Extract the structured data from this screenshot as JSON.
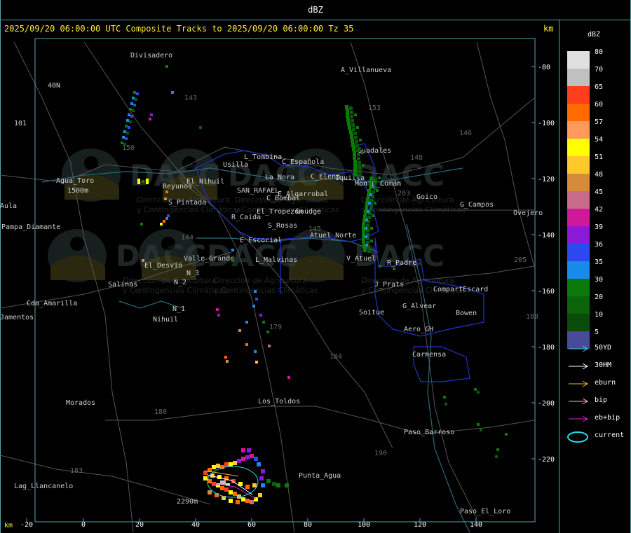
{
  "window": {
    "title": "dBZ"
  },
  "header": {
    "text": "2025/09/20 06:00:00 UTC Composite Tracks to 2025/09/20 06:00:00 Tz 35",
    "km_label": "km"
  },
  "legend": {
    "title": "dBZ",
    "scale": [
      {
        "label": "80",
        "color": "#e0e0e0"
      },
      {
        "label": "70",
        "color": "#c0c0c0"
      },
      {
        "label": "65",
        "color": "#ff3d1f"
      },
      {
        "label": "60",
        "color": "#ff6a00"
      },
      {
        "label": "57",
        "color": "#ff9a5a"
      },
      {
        "label": "54",
        "color": "#ffff00"
      },
      {
        "label": "51",
        "color": "#ffc82a"
      },
      {
        "label": "48",
        "color": "#d68a3a"
      },
      {
        "label": "45",
        "color": "#c86a8a"
      },
      {
        "label": "42",
        "color": "#d0189a"
      },
      {
        "label": "39",
        "color": "#8a1ad8"
      },
      {
        "label": "36",
        "color": "#2a4af0"
      },
      {
        "label": "35",
        "color": "#1a8ae8"
      },
      {
        "label": "30",
        "color": "#0a7a0a"
      },
      {
        "label": "20",
        "color": "#0a640a"
      },
      {
        "label": "10",
        "color": "#0a4a0a"
      },
      {
        "label": "5",
        "color": "#4a4a9a"
      }
    ],
    "tracks": [
      {
        "label": "50YD",
        "color": "#22d8e8"
      },
      {
        "label": "30HM",
        "color": "#ffffff"
      },
      {
        "label": "eburn",
        "color": "#ffb020"
      },
      {
        "label": "bip",
        "color": "#ffb0c0"
      },
      {
        "label": "eb+bip",
        "color": "#e020e0"
      },
      {
        "label": "current",
        "color": "#22d8e8"
      }
    ]
  },
  "axes": {
    "x_ticks": [
      "-20",
      "0",
      "20",
      "40",
      "60",
      "80",
      "100",
      "120",
      "140"
    ],
    "y_ticks": [
      "-80",
      "-100",
      "-120",
      "-140",
      "-160",
      "-180",
      "-200",
      "-220"
    ],
    "x_unit": "km",
    "y_unit": "km"
  },
  "places": [
    "Divisadero",
    "A_Villanueva",
    "40N",
    "101",
    "Agua_Toro",
    "1500m",
    "Aula",
    "Pampa_Diamante",
    "Usilla",
    "L_Tombina",
    "C_Española",
    "La_Nora",
    "C_Elena",
    "Iquilla",
    "Goudge",
    "S_Pintada",
    "Reyunos",
    "El_Nihuil",
    "SAN_RAFAEL",
    "E_Algarrobal",
    "C_Bombal",
    "R_Caída",
    "El_Tropezón",
    "S_Rosas",
    "Atuel_Norte",
    "E_Escorial",
    "L_Malvinas",
    "V_Atuel",
    "R_Padre",
    "Valle_Grande",
    "El_Desvío",
    "Salinas",
    "N_2",
    "N_3",
    "N_1",
    "Nihuil",
    "Cda_Amarilla",
    "Jamentos",
    "J_Prats",
    "CompartEscard",
    "G_Alvear",
    "Bowen",
    "Soitue",
    "Aero_GH",
    "Carmensa",
    "Goico",
    "G_Campos",
    "Ovejero",
    "Guadales",
    "Morados",
    "Los_Toldos",
    "Paso_Barroso",
    "Punta_Agua",
    "Lag_Llancanelo",
    "2290m",
    "Paso_El_Loro",
    "Monte_Comán",
    "153",
    "146",
    "148",
    "143",
    "203",
    "205",
    "179",
    "180",
    "184",
    "183",
    "190",
    "150",
    "144",
    "145",
    "180"
  ],
  "watermark": "DACC",
  "watermark_sub": "Dirección de Agricultura y Contingencias Climáticas"
}
